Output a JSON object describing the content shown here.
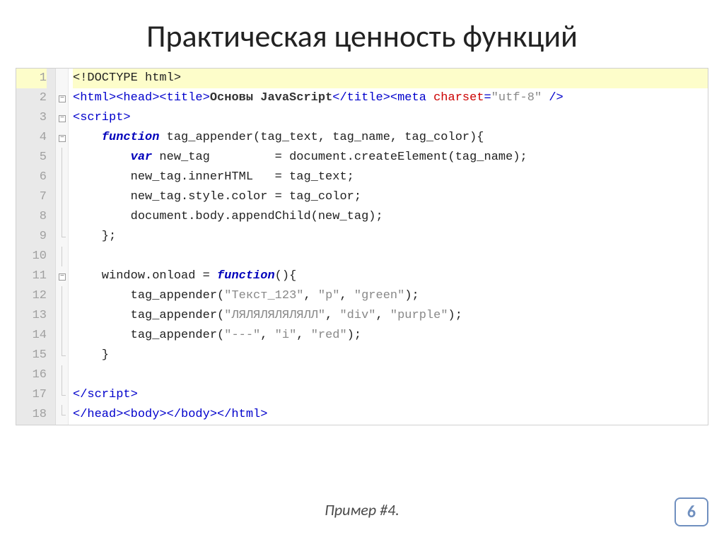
{
  "title": "Практическая ценность функций",
  "caption": "Пример #4.",
  "page_number": "6",
  "code": {
    "lines": [
      {
        "n": "1",
        "fold": "",
        "hl": true,
        "tokens": [
          {
            "t": "<!DOCTYPE html>",
            "c": "t-fn"
          }
        ]
      },
      {
        "n": "2",
        "fold": "box",
        "tokens": [
          {
            "t": "<html><head><title>",
            "c": "t-tag"
          },
          {
            "t": "Основы JavaScript",
            "c": "t-bold"
          },
          {
            "t": "</title><meta ",
            "c": "t-tag"
          },
          {
            "t": "charset",
            "c": "t-attr"
          },
          {
            "t": "=",
            "c": "t-tag"
          },
          {
            "t": "\"utf-8\"",
            "c": "t-str"
          },
          {
            "t": " />",
            "c": "t-tag"
          }
        ]
      },
      {
        "n": "3",
        "fold": "box",
        "tokens": [
          {
            "t": "<script>",
            "c": "t-tag"
          }
        ]
      },
      {
        "n": "4",
        "fold": "box",
        "tokens": [
          {
            "t": "    ",
            "c": ""
          },
          {
            "t": "function",
            "c": "t-kw"
          },
          {
            "t": " tag_appender(tag_text, tag_name, tag_color){",
            "c": "t-fn"
          }
        ]
      },
      {
        "n": "5",
        "fold": "line",
        "tokens": [
          {
            "t": "        ",
            "c": ""
          },
          {
            "t": "var",
            "c": "t-kw"
          },
          {
            "t": " new_tag         = document.createElement(tag_name);",
            "c": "t-fn"
          }
        ]
      },
      {
        "n": "6",
        "fold": "line",
        "tokens": [
          {
            "t": "        new_tag.innerHTML   = tag_text;",
            "c": "t-fn"
          }
        ]
      },
      {
        "n": "7",
        "fold": "line",
        "tokens": [
          {
            "t": "        new_tag.style.color = tag_color;",
            "c": "t-fn"
          }
        ]
      },
      {
        "n": "8",
        "fold": "line",
        "tokens": [
          {
            "t": "        document.body.appendChild(new_tag);",
            "c": "t-fn"
          }
        ]
      },
      {
        "n": "9",
        "fold": "end",
        "tokens": [
          {
            "t": "    };",
            "c": "t-fn"
          }
        ]
      },
      {
        "n": "10",
        "fold": "line",
        "tokens": [
          {
            "t": "",
            "c": ""
          }
        ]
      },
      {
        "n": "11",
        "fold": "box",
        "tokens": [
          {
            "t": "    window.onload = ",
            "c": "t-fn"
          },
          {
            "t": "function",
            "c": "t-kw"
          },
          {
            "t": "(){",
            "c": "t-fn"
          }
        ]
      },
      {
        "n": "12",
        "fold": "line",
        "tokens": [
          {
            "t": "        tag_appender(",
            "c": "t-fn"
          },
          {
            "t": "\"Текст_123\"",
            "c": "t-str"
          },
          {
            "t": ", ",
            "c": "t-fn"
          },
          {
            "t": "\"p\"",
            "c": "t-str"
          },
          {
            "t": ", ",
            "c": "t-fn"
          },
          {
            "t": "\"green\"",
            "c": "t-str"
          },
          {
            "t": ");",
            "c": "t-fn"
          }
        ]
      },
      {
        "n": "13",
        "fold": "line",
        "tokens": [
          {
            "t": "        tag_appender(",
            "c": "t-fn"
          },
          {
            "t": "\"ЛЯЛЯЛЯЛЯЛЯЛЛ\"",
            "c": "t-str"
          },
          {
            "t": ", ",
            "c": "t-fn"
          },
          {
            "t": "\"div\"",
            "c": "t-str"
          },
          {
            "t": ", ",
            "c": "t-fn"
          },
          {
            "t": "\"purple\"",
            "c": "t-str"
          },
          {
            "t": ");",
            "c": "t-fn"
          }
        ]
      },
      {
        "n": "14",
        "fold": "line",
        "tokens": [
          {
            "t": "        tag_appender(",
            "c": "t-fn"
          },
          {
            "t": "\"---\"",
            "c": "t-str"
          },
          {
            "t": ", ",
            "c": "t-fn"
          },
          {
            "t": "\"i\"",
            "c": "t-str"
          },
          {
            "t": ", ",
            "c": "t-fn"
          },
          {
            "t": "\"red\"",
            "c": "t-str"
          },
          {
            "t": ");",
            "c": "t-fn"
          }
        ]
      },
      {
        "n": "15",
        "fold": "end",
        "tokens": [
          {
            "t": "    }",
            "c": "t-fn"
          }
        ]
      },
      {
        "n": "16",
        "fold": "line",
        "tokens": [
          {
            "t": "",
            "c": ""
          }
        ]
      },
      {
        "n": "17",
        "fold": "end",
        "tokens": [
          {
            "t": "</script>",
            "c": "t-tag"
          }
        ]
      },
      {
        "n": "18",
        "fold": "end",
        "tokens": [
          {
            "t": "</head><body></body></html>",
            "c": "t-tag"
          }
        ]
      }
    ]
  }
}
